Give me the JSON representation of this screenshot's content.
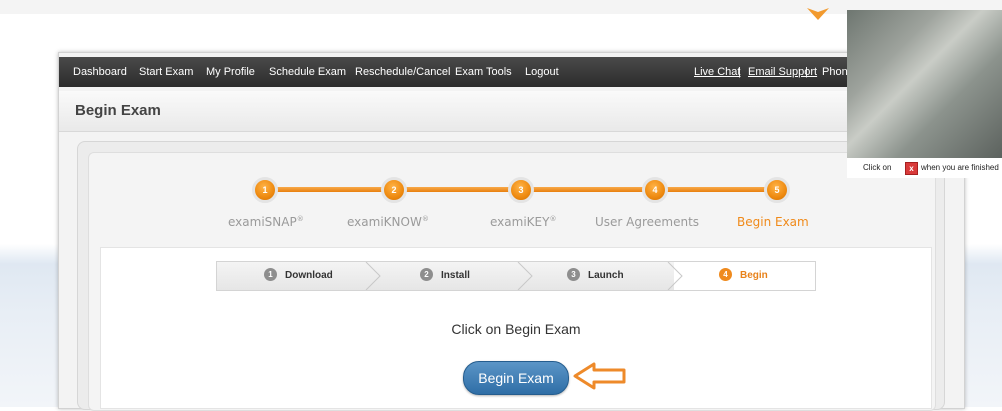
{
  "nav": {
    "items": [
      "Dashboard",
      "Start Exam",
      "My Profile",
      "Schedule Exam",
      "Reschedule/Cancel",
      "Exam Tools",
      "Logout"
    ],
    "right": {
      "live_chat": "Live Chat",
      "email_support": "Email Support",
      "phone": "Phone",
      "separator": "|"
    }
  },
  "page": {
    "title": "Begin Exam"
  },
  "steps": [
    {
      "num": "1",
      "label": "examiSNAP",
      "mark": "®"
    },
    {
      "num": "2",
      "label": "examiKNOW",
      "mark": "®"
    },
    {
      "num": "3",
      "label": "examiKEY",
      "mark": "®"
    },
    {
      "num": "4",
      "label": "User Agreements",
      "mark": ""
    },
    {
      "num": "5",
      "label": "Begin Exam",
      "mark": ""
    }
  ],
  "tabs": [
    {
      "num": "1",
      "label": "Download"
    },
    {
      "num": "2",
      "label": "Install"
    },
    {
      "num": "3",
      "label": "Launch"
    },
    {
      "num": "4",
      "label": "Begin"
    }
  ],
  "main": {
    "instruction": "Click on Begin Exam",
    "button_label": "Begin Exam"
  },
  "webcam": {
    "prefix": "Click on",
    "close_glyph": "x",
    "suffix": "when you are finished"
  },
  "colors": {
    "accent": "#F08A1A",
    "nav_bg": "#333333",
    "button": "#3A77AE"
  }
}
